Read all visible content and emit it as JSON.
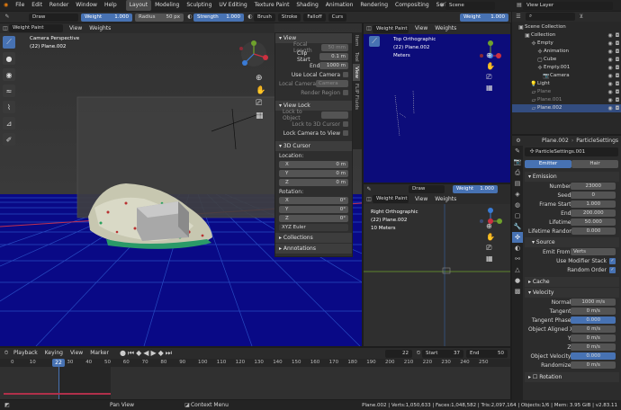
{
  "menubar": {
    "items": [
      "File",
      "Edit",
      "Render",
      "Window",
      "Help"
    ],
    "workspaces": [
      "Layout",
      "Modeling",
      "Sculpting",
      "UV Editing",
      "Texture Paint",
      "Shading",
      "Animation",
      "Rendering",
      "Compositing",
      "Scripting"
    ],
    "active_workspace": "Layout",
    "scene": "Scene",
    "view_layer": "View Layer"
  },
  "tool_header": {
    "brush": "Draw",
    "weight_label": "Weight",
    "weight_value": "1.000",
    "radius_label": "Radius",
    "radius_value": "50 px",
    "strength_label": "Strength",
    "strength_value": "1.000",
    "menus": [
      "Brush",
      "Stroke",
      "Falloff",
      "Curs"
    ],
    "weight2_label": "Weight",
    "weight2_value": "1.000"
  },
  "viewport_main": {
    "mode": "Weight Paint",
    "menus": [
      "View",
      "Weights"
    ],
    "overlay_line1": "Camera Perspective",
    "overlay_line2": "(22) Plane.002"
  },
  "npanel": {
    "tabs": [
      "Item",
      "Tool",
      "View",
      "FLIP Fluids"
    ],
    "view_title": "View",
    "focal_label": "Focal Length",
    "focal_value": "50 mm",
    "clip_start_label": "Clip Start",
    "clip_start_value": "0.1 m",
    "end_label": "End",
    "end_value": "1000 m",
    "use_local_camera": "Use Local Camera",
    "local_camera": "Local Camera",
    "camera": "Camera",
    "render_region": "Render Region",
    "view_lock": "View Lock",
    "lock_object": "Lock to Object",
    "lock_3d_cursor": "Lock to 3D Cursor",
    "lock_camera": "Lock Camera to View",
    "cursor_title": "3D Cursor",
    "location": "Location:",
    "loc": [
      {
        "axis": "X",
        "value": "0 m"
      },
      {
        "axis": "Y",
        "value": "0 m"
      },
      {
        "axis": "Z",
        "value": "0 m"
      }
    ],
    "rotation": "Rotation:",
    "rot": [
      {
        "axis": "X",
        "value": "0°"
      },
      {
        "axis": "Y",
        "value": "0°"
      },
      {
        "axis": "Z",
        "value": "0°"
      }
    ],
    "rot_mode": "XYZ Euler",
    "collections": "Collections",
    "annotations": "Annotations"
  },
  "viewport_top": {
    "mode": "Weight Paint",
    "menus": [
      "View",
      "Weights"
    ],
    "line1": "Top Orthographic",
    "line2": "(22) Plane.002",
    "line3": "Meters",
    "brush": "Draw",
    "weight": "Weight",
    "weight_value": "1.000"
  },
  "viewport_right": {
    "mode": "Weight Paint",
    "menus": [
      "View",
      "Weights"
    ],
    "line1": "Right Orthographic",
    "line2": "(22) Plane.002",
    "line3": "10 Meters"
  },
  "outliner": {
    "title": "Scene Collection",
    "items": [
      {
        "name": "Collection",
        "depth": 1
      },
      {
        "name": "Empty",
        "depth": 2
      },
      {
        "name": "Animation",
        "depth": 3
      },
      {
        "name": "Cube",
        "depth": 3
      },
      {
        "name": "Empty.001",
        "depth": 3
      },
      {
        "name": "Camera",
        "depth": 4
      },
      {
        "name": "Light",
        "depth": 2
      },
      {
        "name": "Plane",
        "depth": 2
      },
      {
        "name": "Plane.001",
        "depth": 2
      },
      {
        "name": "Plane.002",
        "depth": 2
      }
    ]
  },
  "properties": {
    "object": "Plane.002",
    "psettings": "ParticleSettings",
    "psettings_name": "ParticleSettings.001",
    "tab_emitter": "Emitter",
    "tab_hair": "Hair",
    "emission": "Emission",
    "fields": [
      {
        "label": "Number",
        "value": "23000"
      },
      {
        "label": "Seed",
        "value": "0"
      },
      {
        "label": "Frame Start",
        "value": "1.000"
      },
      {
        "label": "End",
        "value": "200.000"
      },
      {
        "label": "Lifetime",
        "value": "50.000"
      },
      {
        "label": "Lifetime Random...",
        "value": "0.000"
      }
    ],
    "source": "Source",
    "emit_from_label": "Emit From",
    "emit_from_value": "Verts",
    "use_modifier_stack": "Use Modifier Stack",
    "random_order": "Random Order",
    "cache": "Cache",
    "velocity": "Velocity",
    "vel_fields": [
      {
        "label": "Normal",
        "value": "1000 m/s"
      },
      {
        "label": "Tangent",
        "value": "0 m/s"
      },
      {
        "label": "Tangent Phase",
        "value": "0.000"
      },
      {
        "label": "Object Aligned X",
        "value": "0 m/s"
      },
      {
        "label": "Y",
        "value": "0 m/s"
      },
      {
        "label": "Z",
        "value": "0 m/s"
      },
      {
        "label": "Object Velocity",
        "value": "0.000"
      },
      {
        "label": "Randomize",
        "value": "0 m/s"
      }
    ],
    "rotation": "Rotation"
  },
  "timeline": {
    "menus": [
      "Playback",
      "Keying",
      "View",
      "Marker"
    ],
    "current": "22",
    "start_label": "Start",
    "start": "37",
    "end_label": "End",
    "end": "50",
    "ticks": [
      "0",
      "10",
      "22",
      "30",
      "40",
      "50",
      "60",
      "70",
      "80",
      "90",
      "100",
      "110",
      "120",
      "130",
      "140",
      "150",
      "160",
      "170",
      "180",
      "190",
      "200",
      "210",
      "220",
      "230",
      "240",
      "250"
    ]
  },
  "statusbar": {
    "pan": "Pan View",
    "context": "Context Menu",
    "stats": "Plane.002 | Verts:1,050,633 | Faces:1,048,582 | Tris:2,097,164 | Objects:1/6 | Mem: 3.95 GiB | v2.83.11"
  },
  "colors": {
    "accent": "#4772b3",
    "viewport_bg": "#0c0c7a"
  }
}
